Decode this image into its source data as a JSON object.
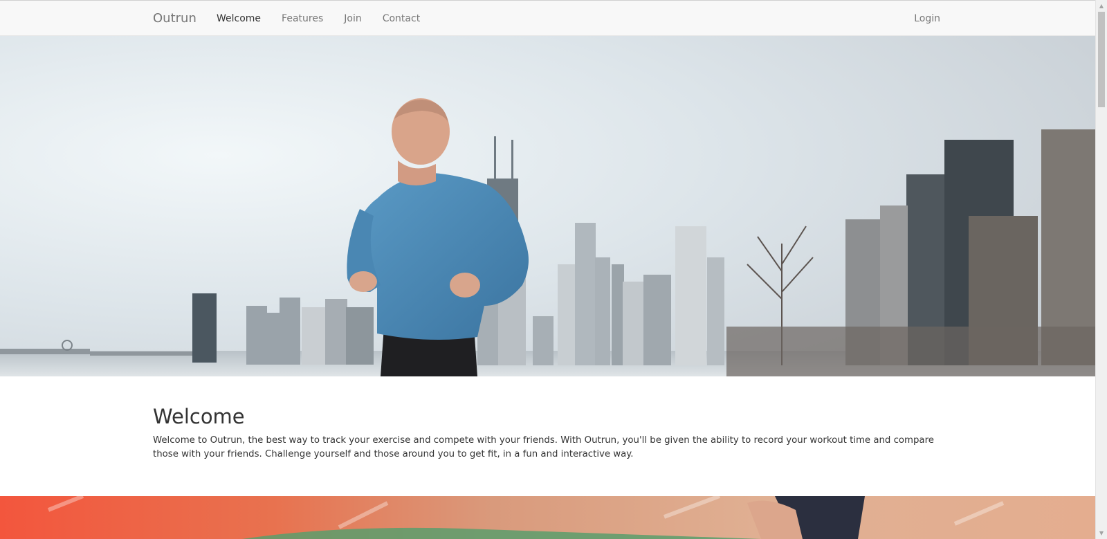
{
  "navbar": {
    "brand": "Outrun",
    "items": [
      {
        "label": "Welcome",
        "active": true
      },
      {
        "label": "Features",
        "active": false
      },
      {
        "label": "Join",
        "active": false
      },
      {
        "label": "Contact",
        "active": false
      }
    ],
    "login": "Login"
  },
  "welcome": {
    "heading": "Welcome",
    "body": "Welcome to Outrun, the best way to track your exercise and compete with your friends. With Outrun, you'll be given the ability to record your workout time and compare those with your friends. Challenge yourself and those around you to get fit, in a fun and interactive way."
  },
  "icons": {
    "scroll_up": "scroll-up-arrow-icon",
    "scroll_down": "scroll-down-arrow-icon"
  },
  "colors": {
    "navbar_bg": "#f8f8f8",
    "nav_text": "#777777",
    "nav_active": "#333333",
    "shirt": "#4a87b3",
    "banner_orange": "#f36a4b"
  }
}
